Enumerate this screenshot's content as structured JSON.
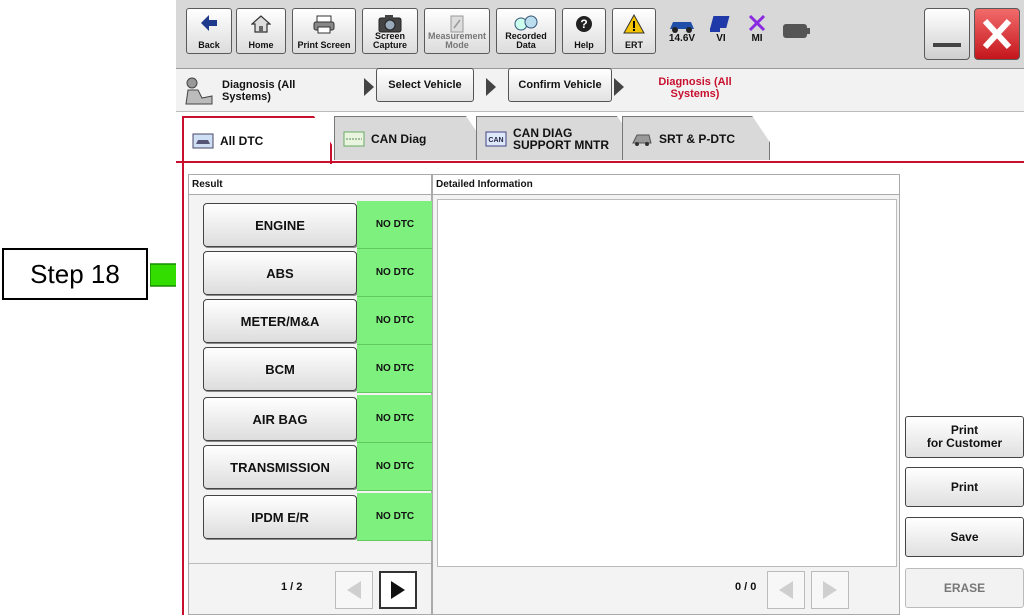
{
  "callout": {
    "label": "Step 18"
  },
  "toolbar": {
    "back": "Back",
    "home": "Home",
    "print_screen": "Print Screen",
    "screen_capture_1": "Screen",
    "screen_capture_2": "Capture",
    "measurement_1": "Measurement",
    "measurement_2": "Mode",
    "recorded_1": "Recorded",
    "recorded_2": "Data",
    "help": "Help",
    "ert": "ERT",
    "voltage": "14.6V",
    "vi": "VI",
    "mi": "MI"
  },
  "breadcrumb": {
    "home_label_1": "Diagnosis (All",
    "home_label_2": "Systems)",
    "select_vehicle": "Select Vehicle",
    "confirm_vehicle": "Confirm Vehicle",
    "current_1": "Diagnosis (All",
    "current_2": "Systems)"
  },
  "tabs": {
    "all_dtc": "All DTC",
    "can_diag": "CAN Diag",
    "can_diag_support_1": "CAN DIAG",
    "can_diag_support_2": "SUPPORT MNTR",
    "srt_pdtc": "SRT & P-DTC"
  },
  "result": {
    "header": "Result",
    "systems": [
      {
        "name": "ENGINE",
        "status": "NO DTC"
      },
      {
        "name": "ABS",
        "status": "NO DTC"
      },
      {
        "name": "METER/M&A",
        "status": "NO DTC"
      },
      {
        "name": "BCM",
        "status": "NO DTC"
      },
      {
        "name": "AIR BAG",
        "status": "NO DTC"
      },
      {
        "name": "TRANSMISSION",
        "status": "NO DTC"
      },
      {
        "name": "IPDM E/R",
        "status": "NO DTC"
      }
    ],
    "page": "1 / 2"
  },
  "detail": {
    "header": "Detailed Information",
    "page": "0 / 0"
  },
  "side": {
    "print_customer_1": "Print",
    "print_customer_2": "for Customer",
    "print": "Print",
    "save": "Save",
    "erase": "ERASE"
  },
  "colors": {
    "accent": "#c8102e",
    "status_ok": "#7ef07e",
    "arrow": "#33dd00"
  }
}
